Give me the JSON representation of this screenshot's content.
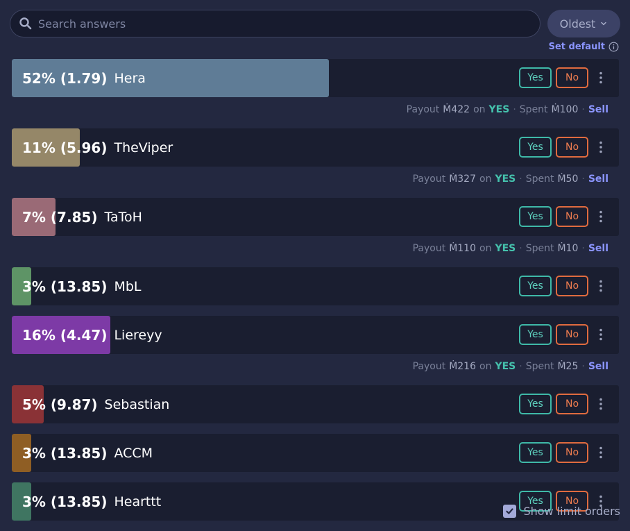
{
  "search": {
    "placeholder": "Search answers"
  },
  "sort": {
    "label": "Oldest"
  },
  "set_default": {
    "label": "Set default"
  },
  "answers": [
    {
      "percent_label": "52% (1.79)",
      "name": "Hera",
      "probability": 0.52,
      "color": "#5f7c96",
      "yes_label": "Yes",
      "no_label": "No",
      "payout": {
        "payout_label": "Payout",
        "payout_amount": "Ṁ422",
        "on_label": "on",
        "side": "YES",
        "spent_label": "Spent",
        "spent_amount": "Ṁ100",
        "sell_label": "Sell"
      }
    },
    {
      "percent_label": "11% (5.96)",
      "name": "TheViper",
      "probability": 0.11,
      "color": "#958768",
      "yes_label": "Yes",
      "no_label": "No",
      "payout": {
        "payout_label": "Payout",
        "payout_amount": "Ṁ327",
        "on_label": "on",
        "side": "YES",
        "spent_label": "Spent",
        "spent_amount": "Ṁ50",
        "sell_label": "Sell"
      }
    },
    {
      "percent_label": "7% (7.85)",
      "name": "TaToH",
      "probability": 0.07,
      "color": "#9a6a76",
      "yes_label": "Yes",
      "no_label": "No",
      "payout": {
        "payout_label": "Payout",
        "payout_amount": "Ṁ110",
        "on_label": "on",
        "side": "YES",
        "spent_label": "Spent",
        "spent_amount": "Ṁ10",
        "sell_label": "Sell"
      }
    },
    {
      "percent_label": "3% (13.85)",
      "name": "MbL",
      "probability": 0.03,
      "color": "#5e9466",
      "yes_label": "Yes",
      "no_label": "No",
      "payout": null
    },
    {
      "percent_label": "16% (4.47)",
      "name": "Liereyy",
      "probability": 0.16,
      "color": "#7d3aa6",
      "yes_label": "Yes",
      "no_label": "No",
      "payout": {
        "payout_label": "Payout",
        "payout_amount": "Ṁ216",
        "on_label": "on",
        "side": "YES",
        "spent_label": "Spent",
        "spent_amount": "Ṁ25",
        "sell_label": "Sell"
      }
    },
    {
      "percent_label": "5% (9.87)",
      "name": "Sebastian",
      "probability": 0.05,
      "color": "#8a3236",
      "yes_label": "Yes",
      "no_label": "No",
      "payout": null
    },
    {
      "percent_label": "3% (13.85)",
      "name": "ACCM",
      "probability": 0.03,
      "color": "#8f5e24",
      "yes_label": "Yes",
      "no_label": "No",
      "payout": null
    },
    {
      "percent_label": "3% (13.85)",
      "name": "Hearttt",
      "probability": 0.03,
      "color": "#3f7561",
      "yes_label": "Yes",
      "no_label": "No",
      "payout": null
    }
  ],
  "limit_orders": {
    "label": "Show limit orders",
    "checked": true
  }
}
